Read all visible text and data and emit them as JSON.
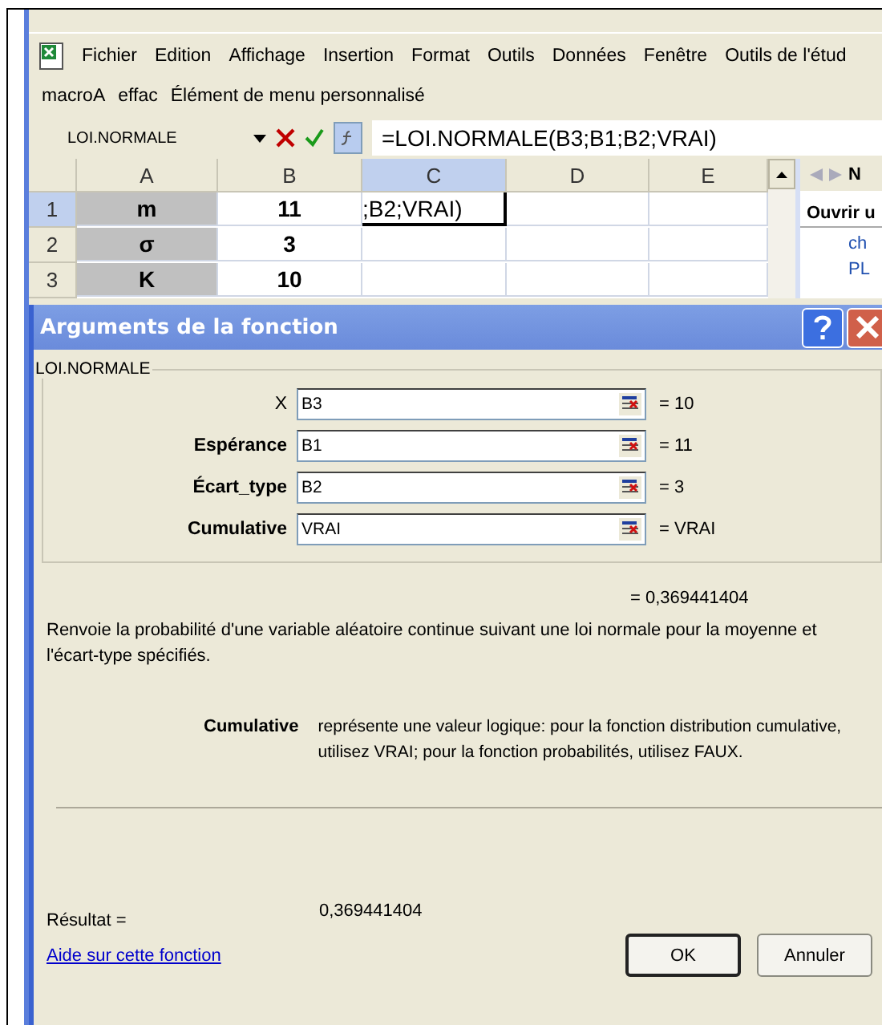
{
  "menu": [
    "Fichier",
    "Edition",
    "Affichage",
    "Insertion",
    "Format",
    "Outils",
    "Données",
    "Fenêtre",
    "Outils de l'étud"
  ],
  "custom_menu": [
    "macroA",
    "effac",
    "Élément de menu personnalisé"
  ],
  "formula_bar": {
    "name_box": "LOI.NORMALE",
    "formula": "=LOI.NORMALE(B3;B1;B2;VRAI)"
  },
  "sheet": {
    "columns": [
      {
        "label": "A",
        "selected": false
      },
      {
        "label": "B",
        "selected": false
      },
      {
        "label": "C",
        "selected": true
      },
      {
        "label": "D",
        "selected": false
      },
      {
        "label": "E",
        "selected": false
      }
    ],
    "rows": [
      {
        "header": "1",
        "selected": true,
        "cells": [
          {
            "text": "m",
            "shaded": true,
            "active": false
          },
          {
            "text": "11",
            "shaded": false,
            "active": false
          },
          {
            "text": ";B2;VRAI)",
            "shaded": false,
            "active": true
          },
          {
            "text": "",
            "shaded": false,
            "active": false
          },
          {
            "text": "",
            "shaded": false,
            "active": false
          }
        ]
      },
      {
        "header": "2",
        "selected": false,
        "cells": [
          {
            "text": "σ",
            "shaded": true,
            "active": false
          },
          {
            "text": "3",
            "shaded": false,
            "active": false
          },
          {
            "text": "",
            "shaded": false,
            "active": false
          },
          {
            "text": "",
            "shaded": false,
            "active": false
          },
          {
            "text": "",
            "shaded": false,
            "active": false
          }
        ]
      },
      {
        "header": "3",
        "selected": false,
        "cells": [
          {
            "text": "K",
            "shaded": true,
            "active": false
          },
          {
            "text": "10",
            "shaded": false,
            "active": false
          },
          {
            "text": "",
            "shaded": false,
            "active": false
          },
          {
            "text": "",
            "shaded": false,
            "active": false
          },
          {
            "text": "",
            "shaded": false,
            "active": false
          }
        ]
      }
    ]
  },
  "task_pane": {
    "nav_label": "N",
    "heading": "Ouvrir u",
    "links": [
      "ch",
      "PL"
    ]
  },
  "dialog": {
    "title": "Arguments de la fonction",
    "group_label": "LOI.NORMALE",
    "arguments": [
      {
        "label": "X",
        "value": "B3",
        "result": "= 10"
      },
      {
        "label": "Espérance",
        "value": "B1",
        "result": "= 11"
      },
      {
        "label": "Écart_type",
        "value": "B2",
        "result": "= 3"
      },
      {
        "label": "Cumulative",
        "value": "VRAI",
        "result": "= VRAI"
      }
    ],
    "formula_result": "= 0,369441404",
    "description": "Renvoie la probabilité d'une variable aléatoire continue suivant une loi normale pour la moyenne et l'écart-type spécifiés.",
    "argument_help": {
      "name": "Cumulative",
      "text": "représente une valeur logique: pour la fonction distribution cumulative, utilisez VRAI; pour la fonction probabilités, utilisez FAUX."
    },
    "result_label": "Résultat =",
    "result_value": "0,369441404",
    "help_link": "Aide sur cette fonction",
    "buttons": [
      {
        "label": "OK",
        "default": true
      },
      {
        "label": "Annuler",
        "default": false
      }
    ]
  }
}
